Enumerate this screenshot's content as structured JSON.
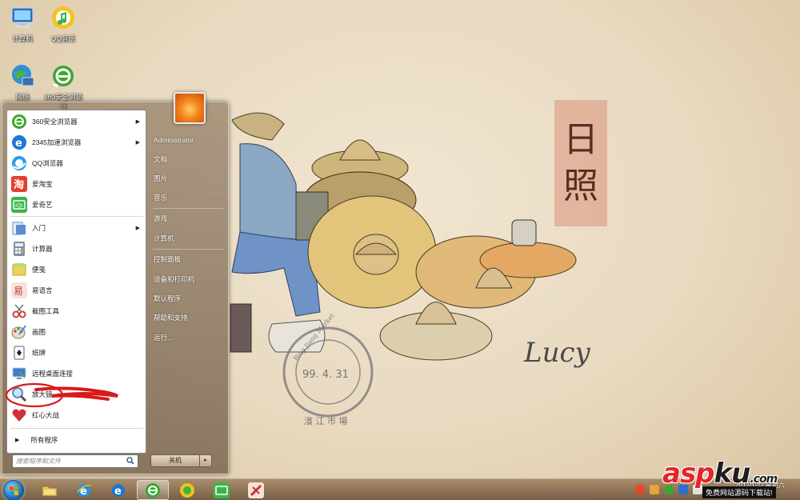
{
  "desktop": {
    "icons": [
      {
        "label": "计算机",
        "icon": "computer-icon"
      },
      {
        "label": "QQ音乐",
        "icon": "qq-music-icon"
      },
      {
        "label": "网络",
        "icon": "network-icon"
      },
      {
        "label": "360安全浏览器",
        "icon": "360-browser-icon"
      }
    ],
    "wallpaper": {
      "title_chars": [
        "日",
        "照"
      ],
      "stamp_text": "99. 4. 31",
      "stamp_ring_text": "Bing Jiang Market",
      "stamp_bottom_text": "濱 江 市 場",
      "signature": "Lucy"
    }
  },
  "start_menu": {
    "programs": [
      {
        "label": "360安全浏览器",
        "icon": "360-browser-icon",
        "submenu": true,
        "color": "#3aa82f"
      },
      {
        "label": "2345加速浏览器",
        "icon": "2345-browser-icon",
        "submenu": true,
        "color": "#1d78d2"
      },
      {
        "label": "QQ浏览器",
        "icon": "qq-browser-icon",
        "submenu": false,
        "color": "#2a9be8"
      },
      {
        "label": "爱淘宝",
        "icon": "taobao-icon",
        "submenu": false,
        "color": "#e2402d"
      },
      {
        "label": "爱奇艺",
        "icon": "iqiyi-icon",
        "submenu": false,
        "color": "#3ab54a"
      },
      {
        "label": "入门",
        "icon": "getting-started-icon",
        "submenu": true,
        "color": "#5b8fd0"
      },
      {
        "label": "计算器",
        "icon": "calculator-icon",
        "submenu": false,
        "color": "#7d8fa8"
      },
      {
        "label": "便笺",
        "icon": "sticky-notes-icon",
        "submenu": false,
        "color": "#e8d65a"
      },
      {
        "label": "易语言",
        "icon": "eyuyan-icon",
        "submenu": false,
        "color": "#c23a2b"
      },
      {
        "label": "截图工具",
        "icon": "snipping-tool-icon",
        "submenu": false,
        "color": "#cf3d3d"
      },
      {
        "label": "画图",
        "icon": "paint-icon",
        "submenu": false,
        "color": "#4c88c9"
      },
      {
        "label": "纸牌",
        "icon": "solitaire-icon",
        "submenu": false,
        "color": "#d9d9d9"
      },
      {
        "label": "远程桌面连接",
        "icon": "remote-desktop-icon",
        "submenu": false,
        "color": "#3f7cc6"
      },
      {
        "label": "放大镜",
        "icon": "magnifier-icon",
        "submenu": false,
        "color": "#5a8ec2"
      },
      {
        "label": "红心大战",
        "icon": "hearts-icon",
        "submenu": false,
        "color": "#d0303a"
      }
    ],
    "all_programs": "所有程序",
    "search_placeholder": "搜索程序和文件",
    "right_links": [
      "Administrator",
      "文档",
      "图片",
      "音乐",
      "游戏",
      "计算机",
      "控制面板",
      "设备和打印机",
      "默认程序",
      "帮助和支持",
      "运行..."
    ],
    "shutdown_label": "关机",
    "shutdown_arrow": "▸"
  },
  "taskbar": {
    "pinned": [
      {
        "name": "explorer",
        "icon": "folder-icon",
        "color": "#e8c35a",
        "active": false
      },
      {
        "name": "ie",
        "icon": "ie-icon",
        "color": "#2d8fdc",
        "active": false
      },
      {
        "name": "ie2",
        "icon": "ie-blue-icon",
        "color": "#1c78c8",
        "active": false
      },
      {
        "name": "360",
        "icon": "360-browser-icon",
        "color": "#3aa82f",
        "active": true
      },
      {
        "name": "qqmusic",
        "icon": "qq-music-icon",
        "color": "#f1c21b",
        "active": false
      },
      {
        "name": "iqiyi",
        "icon": "iqiyi-icon",
        "color": "#3ab54a",
        "active": false
      },
      {
        "name": "eyuyan",
        "icon": "eyuyan-icon",
        "color": "#c23a2b",
        "active": false
      }
    ],
    "clock_time": "",
    "clock_date": "2017/12/2 星期六"
  },
  "watermark": {
    "logo_part1": "asp",
    "logo_part2": "ku",
    "logo_part3": ".com",
    "subtitle": "免费网站源码下载站!"
  }
}
